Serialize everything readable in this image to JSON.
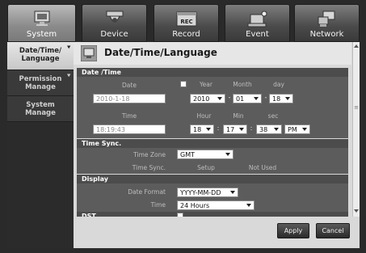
{
  "tabs": [
    {
      "label": "System",
      "icon": "monitor-icon",
      "active": true
    },
    {
      "label": "Device",
      "icon": "camera-icon",
      "active": false
    },
    {
      "label": "Record",
      "icon": "record-icon",
      "active": false
    },
    {
      "label": "Event",
      "icon": "event-icon",
      "active": false
    },
    {
      "label": "Network",
      "icon": "network-icon",
      "active": false
    }
  ],
  "left_menu": [
    {
      "line1": "Date/Time/",
      "line2": "Language",
      "active": true
    },
    {
      "line1": "Permission",
      "line2": "Manage",
      "active": false
    },
    {
      "line1": "System",
      "line2": "Manage",
      "active": false
    }
  ],
  "page_title": "Date/Time/Language",
  "sections": {
    "datetime": "Date /Time",
    "timesync": "Time Sync.",
    "display": "Display",
    "dst": "DST"
  },
  "datetime": {
    "date_label": "Date",
    "date_value": "2010-1-18",
    "year_label": "Year",
    "month_label": "Month",
    "day_label": "day",
    "year": "2010",
    "month": "01",
    "day": "18",
    "time_label": "Time",
    "time_value": "18:19:43",
    "hour_label": "Hour",
    "min_label": "Min",
    "sec_label": "sec",
    "hour": "18",
    "min": "17",
    "sec": "38",
    "ampm": "PM"
  },
  "timesync": {
    "timezone_label": "Time Zone",
    "timezone": "GMT",
    "sync_label": "Time Sync.",
    "setup": "Setup",
    "status": "Not Used"
  },
  "display": {
    "date_format_label": "Date Format",
    "date_format": "YYYY-MM-DD",
    "time_label": "Time",
    "time_format": "24 Hours"
  },
  "buttons": {
    "apply": "Apply",
    "cancel": "Cancel"
  }
}
